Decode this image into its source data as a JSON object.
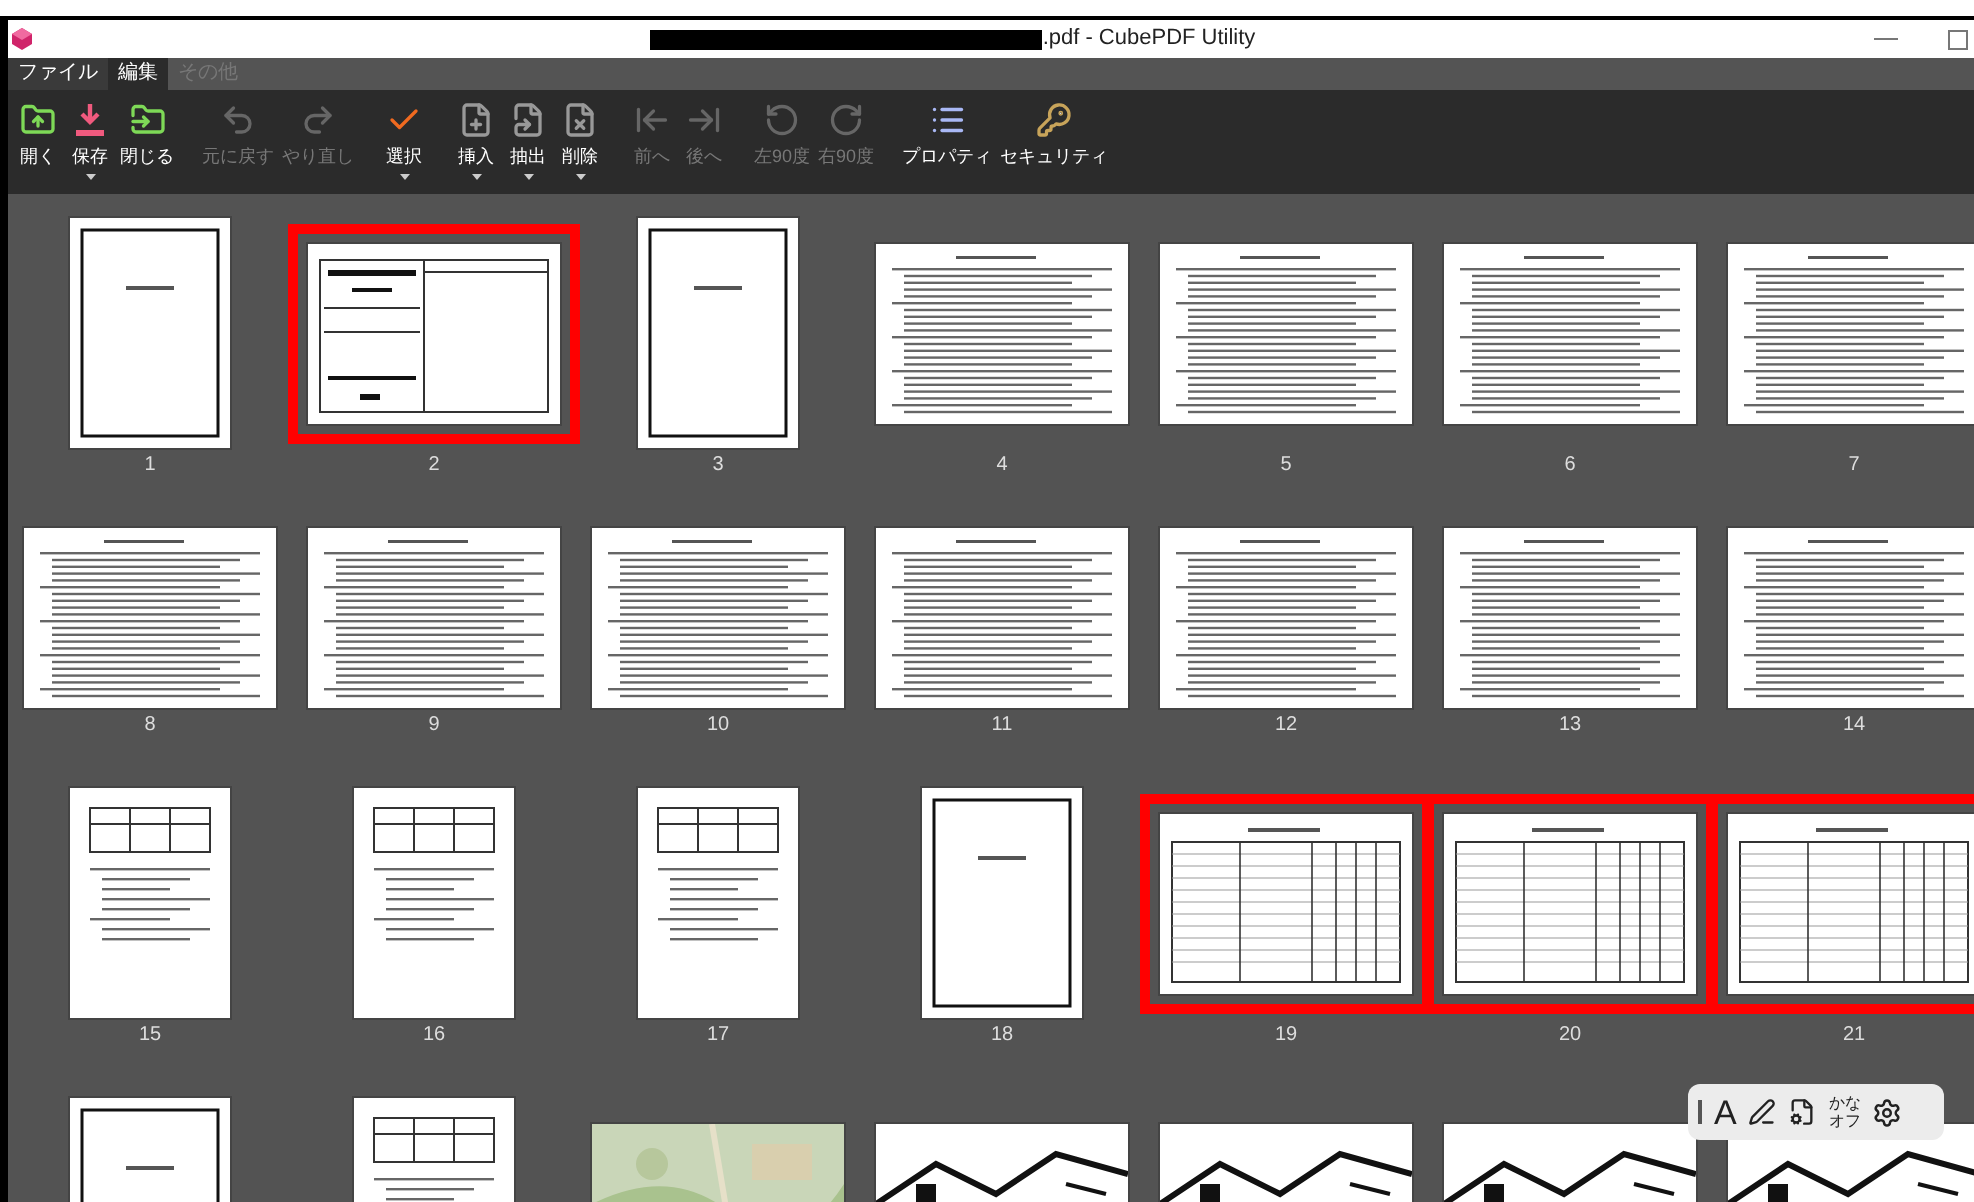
{
  "window": {
    "title_suffix": ".pdf - CubePDF Utility"
  },
  "tabs": [
    {
      "label": "ファイル",
      "selected": false,
      "disabled": false
    },
    {
      "label": "編集",
      "selected": true,
      "disabled": false
    },
    {
      "label": "その他",
      "selected": false,
      "disabled": true
    }
  ],
  "toolbar": [
    {
      "kind": "open",
      "label": "開く",
      "disabled": false,
      "dropdown": false
    },
    {
      "kind": "save",
      "label": "保存",
      "disabled": false,
      "dropdown": true
    },
    {
      "kind": "close",
      "label": "閉じる",
      "disabled": false,
      "dropdown": false
    },
    {
      "kind": "undo",
      "label": "元に戻す",
      "disabled": true,
      "dropdown": false
    },
    {
      "kind": "redo",
      "label": "やり直し",
      "disabled": true,
      "dropdown": false
    },
    {
      "kind": "select",
      "label": "選択",
      "disabled": false,
      "dropdown": true
    },
    {
      "kind": "insert",
      "label": "挿入",
      "disabled": false,
      "dropdown": true
    },
    {
      "kind": "extract",
      "label": "抽出",
      "disabled": false,
      "dropdown": true
    },
    {
      "kind": "remove",
      "label": "削除",
      "disabled": false,
      "dropdown": true
    },
    {
      "kind": "previous",
      "label": "前へ",
      "disabled": true,
      "dropdown": false
    },
    {
      "kind": "next",
      "label": "後へ",
      "disabled": true,
      "dropdown": false
    },
    {
      "kind": "rotate_left",
      "label": "左90度",
      "disabled": true,
      "dropdown": false
    },
    {
      "kind": "rotate_right",
      "label": "右90度",
      "disabled": true,
      "dropdown": false
    },
    {
      "kind": "properties",
      "label": "プロパティ",
      "disabled": false,
      "dropdown": false
    },
    {
      "kind": "security",
      "label": "セキュリティ",
      "disabled": false,
      "dropdown": false
    }
  ],
  "pages": [
    {
      "label": "1",
      "kind": "cover",
      "selected": false
    },
    {
      "label": "2",
      "kind": "form",
      "selected": true
    },
    {
      "label": "3",
      "kind": "cover",
      "selected": false
    },
    {
      "label": "4",
      "kind": "text",
      "selected": false
    },
    {
      "label": "5",
      "kind": "text",
      "selected": false
    },
    {
      "label": "6",
      "kind": "text",
      "selected": false
    },
    {
      "label": "7",
      "kind": "text",
      "selected": false
    },
    {
      "label": "8",
      "kind": "text",
      "selected": false
    },
    {
      "label": "9",
      "kind": "text",
      "selected": false
    },
    {
      "label": "10",
      "kind": "text",
      "selected": false
    },
    {
      "label": "11",
      "kind": "text",
      "selected": false
    },
    {
      "label": "12",
      "kind": "text",
      "selected": false
    },
    {
      "label": "13",
      "kind": "text",
      "selected": false
    },
    {
      "label": "14",
      "kind": "text",
      "selected": false
    },
    {
      "label": "15",
      "kind": "table_portrait",
      "selected": false
    },
    {
      "label": "16",
      "kind": "table_portrait",
      "selected": false
    },
    {
      "label": "17",
      "kind": "table_portrait",
      "selected": false
    },
    {
      "label": "18",
      "kind": "cover",
      "selected": false
    },
    {
      "label": "19",
      "kind": "table",
      "selected": true
    },
    {
      "label": "20",
      "kind": "table",
      "selected": true
    },
    {
      "label": "21",
      "kind": "table",
      "selected": true
    },
    {
      "kind": "cover",
      "selected": false
    },
    {
      "kind": "table_portrait",
      "selected": false
    },
    {
      "kind": "map",
      "selected": false
    },
    {
      "kind": "drawing",
      "selected": false
    },
    {
      "kind": "drawing",
      "selected": false
    },
    {
      "kind": "drawing",
      "selected": false
    },
    {
      "kind": "drawing",
      "selected": false
    }
  ],
  "ime_toolbar": {
    "mode_letter": "A",
    "kana_top": "かな",
    "kana_bottom": "オフ"
  }
}
